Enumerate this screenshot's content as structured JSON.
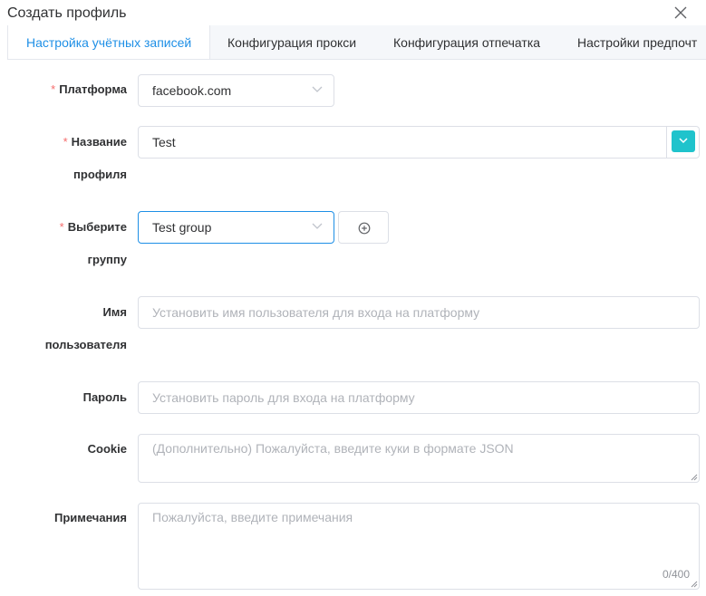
{
  "dialog": {
    "title": "Создать профиль"
  },
  "tabs": [
    {
      "label": "Настройка учётных записей"
    },
    {
      "label": "Конфигурация прокси"
    },
    {
      "label": "Конфигурация отпечатка"
    },
    {
      "label": "Настройки предпочт"
    }
  ],
  "form": {
    "required_mark": "*",
    "platform": {
      "label": "Платформа",
      "value": "facebook.com"
    },
    "profile_name": {
      "label_line1": "Название",
      "label_line2": "профиля",
      "value": "Test"
    },
    "group": {
      "label_line1": "Выберите",
      "label_line2": "группу",
      "value": "Test group"
    },
    "username": {
      "label_line1": "Имя",
      "label_line2": "пользователя",
      "placeholder": "Установить имя пользователя для входа на платформу"
    },
    "password": {
      "label": "Пароль",
      "placeholder": "Установить пароль для входа на платформу"
    },
    "cookie": {
      "label": "Cookie",
      "placeholder": "(Дополнительно) Пожалуйста, введите куки в формате JSON"
    },
    "notes": {
      "label": "Примечания",
      "placeholder": "Пожалуйста, введите примечания",
      "counter": "0/400"
    }
  },
  "colors": {
    "accent": "#1e8fe6",
    "teal": "#1fc3cc",
    "required": "#f56c6c"
  }
}
